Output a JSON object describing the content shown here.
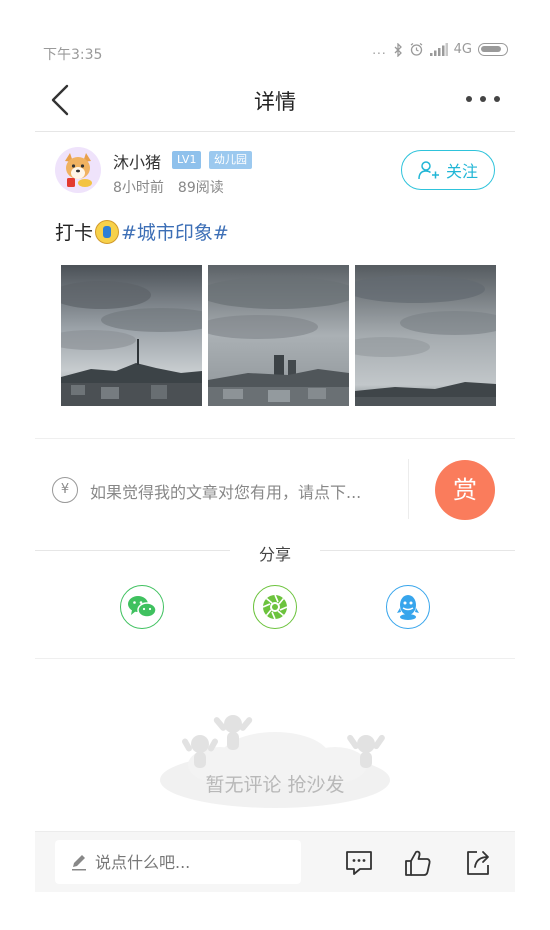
{
  "status_bar": {
    "time": "下午3:35",
    "dots": "...",
    "network": "4G"
  },
  "nav": {
    "title": "详情",
    "back_icon": "chevron-left-icon",
    "more_icon": "more-horizontal-icon"
  },
  "author": {
    "name": "沐小猪",
    "level": "LV1",
    "grade": "幼儿园",
    "time_ago": "8小时前",
    "reads": "89阅读",
    "follow_label": "关注"
  },
  "post": {
    "text": "打卡",
    "tag": "#城市印象#",
    "photos": [
      "city-clouds-photo-1",
      "city-clouds-photo-2",
      "city-clouds-photo-3"
    ]
  },
  "reward": {
    "icon_text": "¥",
    "text": "如果觉得我的文章对您有用，请点下...",
    "button_label": "赏"
  },
  "share": {
    "label": "分享",
    "targets": [
      "wechat-icon",
      "moments-icon",
      "qq-icon"
    ]
  },
  "comments": {
    "empty_text": "暂无评论 抢沙发"
  },
  "bottom_bar": {
    "placeholder": "说点什么吧..."
  },
  "colors": {
    "accent": "#21b6d6",
    "reward": "#fa7c5c",
    "tag": "#3d6fb6",
    "wechat": "#3fc15f",
    "qq": "#37a5ec"
  }
}
